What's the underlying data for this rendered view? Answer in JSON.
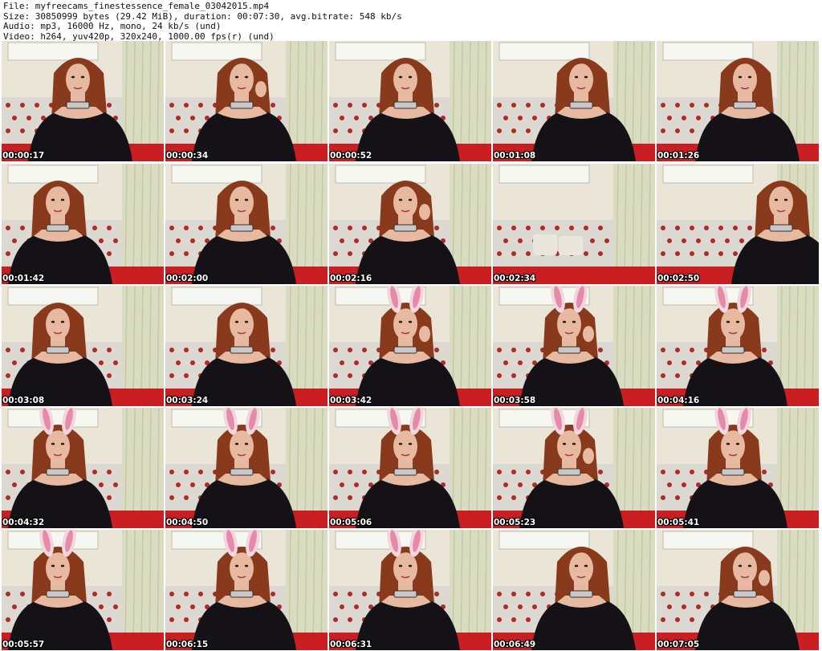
{
  "header": {
    "file": "File: myfreecams_finestessence_female_03042015.mp4",
    "size": "Size: 30850999 bytes (29.42 MiB), duration: 00:07:30, avg.bitrate: 548 kb/s",
    "audio": "Audio: mp3, 16000 Hz, mono, 24 kb/s (und)",
    "video": "Video: h264, yuv420p, 320x240, 1000.00 fps(r) (und)"
  },
  "colors": {
    "wall": "#ebe5d8",
    "curtain": "#d9dcc0",
    "window": "#f7f7f2",
    "sofa": "#dcd8d2",
    "sofa_dots": "#b02a2a",
    "red_cushion": "#c91e22",
    "hair": "#8a3a1c",
    "skin": "#e6b9a0",
    "top": "#141216",
    "necklace": "#c8c8c8",
    "bunny_ears": "#f2d6df",
    "bunny_inner": "#e58aa8"
  },
  "thumbnails": [
    {
      "time": "00:00:17",
      "pose": "center",
      "ears": false,
      "hand": false
    },
    {
      "time": "00:00:34",
      "pose": "center",
      "ears": false,
      "hand": true
    },
    {
      "time": "00:00:52",
      "pose": "center",
      "ears": false,
      "hand": false
    },
    {
      "time": "00:01:08",
      "pose": "right",
      "ears": false,
      "hand": false
    },
    {
      "time": "00:01:26",
      "pose": "right",
      "ears": false,
      "hand": false
    },
    {
      "time": "00:01:42",
      "pose": "left",
      "ears": false,
      "hand": false
    },
    {
      "time": "00:02:00",
      "pose": "center",
      "ears": false,
      "hand": false
    },
    {
      "time": "00:02:16",
      "pose": "center",
      "ears": false,
      "hand": true
    },
    {
      "time": "00:02:34",
      "pose": "empty",
      "ears": false,
      "hand": false
    },
    {
      "time": "00:02:50",
      "pose": "partial",
      "ears": false,
      "hand": false
    },
    {
      "time": "00:03:08",
      "pose": "left",
      "ears": false,
      "hand": false
    },
    {
      "time": "00:03:24",
      "pose": "center",
      "ears": false,
      "hand": false
    },
    {
      "time": "00:03:42",
      "pose": "center",
      "ears": true,
      "hand": true
    },
    {
      "time": "00:03:58",
      "pose": "center",
      "ears": true,
      "hand": true
    },
    {
      "time": "00:04:16",
      "pose": "center",
      "ears": true,
      "hand": false
    },
    {
      "time": "00:04:32",
      "pose": "left",
      "ears": true,
      "hand": false
    },
    {
      "time": "00:04:50",
      "pose": "center",
      "ears": true,
      "hand": false
    },
    {
      "time": "00:05:06",
      "pose": "center",
      "ears": true,
      "hand": false
    },
    {
      "time": "00:05:23",
      "pose": "center",
      "ears": true,
      "hand": true
    },
    {
      "time": "00:05:41",
      "pose": "center",
      "ears": true,
      "hand": false
    },
    {
      "time": "00:05:57",
      "pose": "left",
      "ears": true,
      "hand": false
    },
    {
      "time": "00:06:15",
      "pose": "center",
      "ears": true,
      "hand": false
    },
    {
      "time": "00:06:31",
      "pose": "center",
      "ears": true,
      "hand": false
    },
    {
      "time": "00:06:49",
      "pose": "right",
      "ears": false,
      "hand": false
    },
    {
      "time": "00:07:05",
      "pose": "right",
      "ears": false,
      "hand": true
    }
  ]
}
